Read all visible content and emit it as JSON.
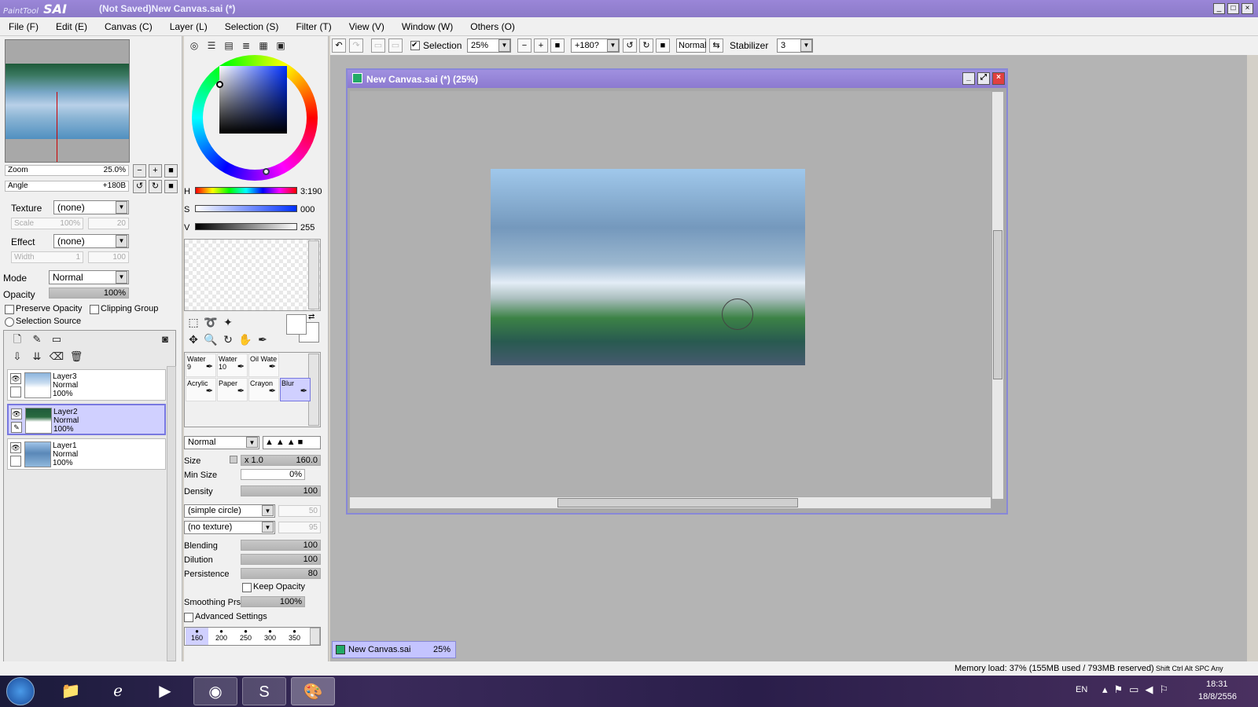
{
  "title": {
    "app_logo_small": "PaintTool",
    "app_logo_big": "SAI",
    "window_title": "(Not Saved)New Canvas.sai (*)"
  },
  "menu": [
    "File (F)",
    "Edit (E)",
    "Canvas (C)",
    "Layer (L)",
    "Selection (S)",
    "Filter (T)",
    "View (V)",
    "Window (W)",
    "Others (O)"
  ],
  "toolbar": {
    "selection_label": "Selection",
    "selection_checked": true,
    "zoom": "25%",
    "angle": "+180?",
    "blend": "Normal",
    "stabilizer_label": "Stabilizer",
    "stabilizer_value": "3"
  },
  "navigator": {
    "zoom_label": "Zoom",
    "zoom_value": "25.0%",
    "angle_label": "Angle",
    "angle_value": "+180B"
  },
  "texture": {
    "label": "Texture",
    "value": "(none)",
    "scale_label": "Scale",
    "scale_value": "100%",
    "scale_val2": "20"
  },
  "effect": {
    "label": "Effect",
    "value": "(none)",
    "width_label": "Width",
    "width_value": "1",
    "width_val2": "100"
  },
  "layer_props": {
    "mode_label": "Mode",
    "mode_value": "Normal",
    "opacity_label": "Opacity",
    "opacity_value": "100%",
    "preserve_opacity": "Preserve Opacity",
    "clipping_group": "Clipping Group",
    "selection_source": "Selection Source"
  },
  "layers": [
    {
      "name": "Layer3",
      "mode": "Normal",
      "opacity": "100%",
      "selected": false
    },
    {
      "name": "Layer2",
      "mode": "Normal",
      "opacity": "100%",
      "selected": true
    },
    {
      "name": "Layer1",
      "mode": "Normal",
      "opacity": "100%",
      "selected": false
    }
  ],
  "color": {
    "h_label": "H",
    "h_value": "3:190",
    "s_label": "S",
    "s_value": "000",
    "v_label": "V",
    "v_value": "255"
  },
  "brushes": [
    {
      "name": "Water",
      "num": "9",
      "selected": false
    },
    {
      "name": "Water",
      "num": "10",
      "selected": false
    },
    {
      "name": "Oil Wate",
      "num": "",
      "selected": false
    },
    {
      "name": "Acrylic",
      "num": "",
      "selected": false
    },
    {
      "name": "Paper",
      "num": "",
      "selected": false
    },
    {
      "name": "Crayon",
      "num": "",
      "selected": false
    },
    {
      "name": "Blur",
      "num": "",
      "selected": true
    }
  ],
  "brush_settings": {
    "blend_mode": "Normal",
    "size_label": "Size",
    "size_mult": "x 1.0",
    "size_value": "160.0",
    "minsize_label": "Min Size",
    "minsize_value": "0%",
    "density_label": "Density",
    "density_value": "100",
    "shape": "(simple circle)",
    "shape_val": "50",
    "texture": "(no texture)",
    "texture_val": "95",
    "blending_label": "Blending",
    "blending_value": "100",
    "dilution_label": "Dilution",
    "dilution_value": "100",
    "persistence_label": "Persistence",
    "persistence_value": "80",
    "keep_opacity": "Keep Opacity",
    "smoothing_label": "Smoothing Prs",
    "smoothing_value": "100%",
    "advanced": "Advanced Settings",
    "sizes": [
      "160",
      "200",
      "250",
      "300",
      "350"
    ]
  },
  "document": {
    "window_title": "New Canvas.sai (*) (25%)",
    "tab_name": "New Canvas.sai",
    "tab_zoom": "25%"
  },
  "status": {
    "memory": "Memory load: 37% (155MB used / 793MB reserved)",
    "keys": [
      "Shift",
      "Ctrl",
      "Alt",
      "SPC",
      "Any"
    ]
  },
  "taskbar": {
    "lang": "EN",
    "time": "18:31",
    "date": "18/8/2556"
  },
  "colors": {
    "accent": "#8c7ac8",
    "selected_layer": "#d0d0ff"
  }
}
